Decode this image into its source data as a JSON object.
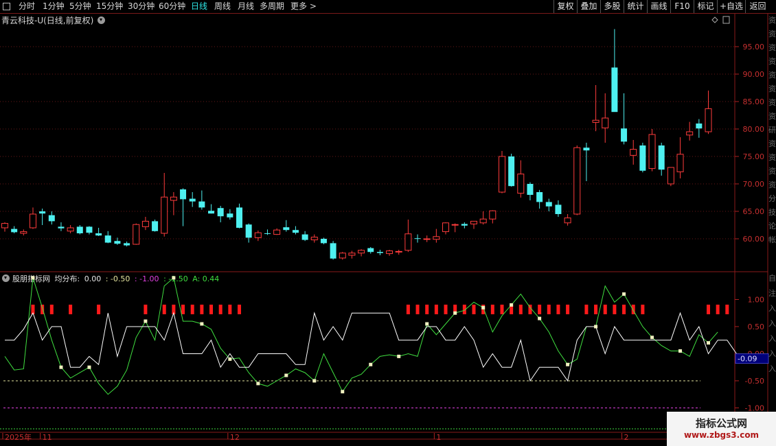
{
  "toolbar": {
    "periods": [
      "分时",
      "1分钟",
      "5分钟",
      "15分钟",
      "30分钟",
      "60分钟",
      "日线",
      "周线",
      "月线",
      "多周期",
      "更多 >"
    ],
    "active_period": "日线",
    "buttons": [
      "复权",
      "叠加",
      "多股",
      "统计",
      "画线",
      "F10",
      "标记",
      "+自选",
      "返回"
    ]
  },
  "main_title": "青云科技-U(日线,前复权)",
  "indicator": {
    "name": "股朋指标网",
    "label": "均分布:",
    "values": [
      {
        "text": "0.00",
        "color": "#e8e8e8"
      },
      {
        "text": ": -0.50",
        "color": "#e6e6a0"
      },
      {
        "text": ": -1.00",
        "color": "#e040e0"
      },
      {
        "text": ": -1.50",
        "color": "#40e040"
      },
      {
        "text": "A: 0.44",
        "color": "#40e040"
      }
    ],
    "current_value": "-0.09"
  },
  "watermark": {
    "title": "指标公式网",
    "url": "www.zbgs3.com"
  },
  "right_strip_chars": [
    "资",
    "资",
    "资",
    "资",
    "资",
    "资",
    "资",
    "资",
    "研",
    "资",
    "资",
    "资",
    "资",
    "分",
    "技",
    "论",
    "帐"
  ],
  "right_strip_chars_lower": [
    "自",
    "注",
    "入",
    "入",
    "入",
    "入",
    "入"
  ],
  "chart_data": [
    {
      "type": "candlestick",
      "title": "青云科技-U(日线,前复权)",
      "y_ticks": [
        60,
        65,
        70,
        75,
        80,
        85,
        90,
        95
      ],
      "ylim": [
        54,
        101
      ],
      "grid": true,
      "date_labels": [
        {
          "label": "2025年",
          "index": 0
        },
        {
          "label": "11",
          "index": 4
        },
        {
          "label": "12",
          "index": 24
        },
        {
          "label": "1",
          "index": 46
        },
        {
          "label": "2",
          "index": 66
        }
      ],
      "up_color": "#ff3c3c",
      "down_color": "#4ef0f0",
      "candles": [
        [
          62.0,
          63.0,
          61.3,
          62.8
        ],
        [
          61.8,
          62.3,
          61.0,
          61.2
        ],
        [
          61.0,
          61.7,
          60.6,
          61.3
        ],
        [
          62.0,
          65.7,
          61.8,
          64.5
        ],
        [
          65.0,
          65.5,
          62.5,
          64.6
        ],
        [
          64.3,
          65.0,
          62.6,
          63.2
        ],
        [
          62.2,
          63.0,
          61.4,
          61.9
        ],
        [
          61.4,
          62.5,
          61.0,
          62.0
        ],
        [
          62.2,
          62.5,
          60.8,
          61.0
        ],
        [
          62.2,
          62.3,
          60.8,
          61.1
        ],
        [
          61.0,
          62.0,
          60.5,
          60.6
        ],
        [
          60.6,
          61.4,
          59.2,
          59.3
        ],
        [
          59.6,
          60.2,
          58.9,
          59.1
        ],
        [
          59.2,
          59.5,
          58.6,
          58.8
        ],
        [
          59.0,
          62.8,
          58.9,
          62.6
        ],
        [
          62.2,
          64.0,
          61.6,
          63.2
        ],
        [
          63.2,
          63.5,
          61.3,
          61.4
        ],
        [
          61.0,
          72.0,
          60.4,
          67.6
        ],
        [
          67.0,
          68.5,
          64.3,
          67.6
        ],
        [
          69.0,
          69.2,
          62.3,
          67.2
        ],
        [
          67.3,
          68.5,
          65.8,
          66.8
        ],
        [
          66.8,
          68.8,
          65.3,
          65.7
        ],
        [
          65.1,
          66.3,
          64.6,
          64.6
        ],
        [
          65.6,
          66.0,
          63.0,
          64.1
        ],
        [
          64.6,
          65.4,
          63.5,
          63.9
        ],
        [
          65.7,
          66.4,
          61.9,
          62.0
        ],
        [
          62.6,
          62.8,
          59.3,
          60.2
        ],
        [
          60.2,
          61.5,
          59.6,
          61.1
        ],
        [
          61.0,
          61.7,
          60.7,
          60.9
        ],
        [
          60.8,
          61.9,
          60.7,
          61.6
        ],
        [
          62.1,
          63.4,
          61.3,
          61.6
        ],
        [
          61.6,
          62.3,
          60.8,
          61.1
        ],
        [
          60.8,
          61.4,
          59.6,
          59.8
        ],
        [
          59.8,
          60.8,
          59.3,
          60.3
        ],
        [
          60.0,
          60.2,
          59.0,
          59.2
        ],
        [
          59.2,
          59.6,
          56.2,
          56.4
        ],
        [
          56.5,
          57.6,
          56.2,
          57.4
        ],
        [
          57.0,
          57.8,
          56.4,
          57.4
        ],
        [
          57.4,
          58.1,
          56.8,
          57.9
        ],
        [
          58.3,
          58.5,
          57.3,
          57.6
        ],
        [
          57.6,
          58.0,
          57.0,
          57.4
        ],
        [
          57.3,
          58.0,
          56.9,
          57.8
        ],
        [
          57.6,
          58.0,
          57.1,
          57.7
        ],
        [
          57.9,
          63.5,
          57.6,
          60.9
        ],
        [
          60.1,
          60.8,
          59.3,
          60.0
        ],
        [
          60.0,
          60.6,
          59.4,
          60.0
        ],
        [
          59.9,
          61.8,
          59.3,
          60.4
        ],
        [
          61.3,
          63.0,
          60.8,
          62.9
        ],
        [
          62.6,
          62.8,
          61.2,
          62.6
        ],
        [
          62.7,
          63.0,
          61.9,
          62.4
        ],
        [
          62.7,
          63.2,
          61.8,
          63.2
        ],
        [
          62.9,
          65.0,
          62.6,
          63.6
        ],
        [
          63.6,
          65.2,
          62.8,
          65.1
        ],
        [
          68.5,
          76.0,
          68.3,
          75.0
        ],
        [
          75.0,
          75.5,
          69.5,
          69.6
        ],
        [
          68.3,
          74.3,
          67.5,
          71.8
        ],
        [
          70.0,
          70.3,
          67.0,
          68.0
        ],
        [
          68.5,
          68.9,
          65.5,
          66.7
        ],
        [
          66.7,
          67.3,
          65.0,
          65.9
        ],
        [
          66.2,
          67.0,
          64.0,
          64.5
        ],
        [
          62.9,
          64.5,
          62.4,
          63.8
        ],
        [
          64.5,
          77.0,
          64.3,
          76.6
        ],
        [
          76.6,
          77.5,
          70.5,
          76.1
        ],
        [
          81.2,
          88.0,
          79.6,
          81.6
        ],
        [
          80.2,
          86.5,
          77.5,
          82.0
        ],
        [
          91.2,
          98.2,
          84.2,
          83.1
        ],
        [
          80.1,
          86.5,
          77.2,
          77.7
        ],
        [
          75.2,
          78.0,
          73.5,
          76.3
        ],
        [
          77.0,
          77.5,
          72.1,
          72.4
        ],
        [
          72.8,
          80.0,
          72.3,
          79.0
        ],
        [
          77.0,
          77.5,
          71.5,
          72.6
        ],
        [
          70.0,
          73.0,
          69.6,
          73.0
        ],
        [
          72.2,
          78.5,
          71.0,
          75.4
        ],
        [
          78.9,
          81.3,
          77.9,
          79.5
        ],
        [
          81.0,
          81.8,
          78.4,
          80.1
        ],
        [
          79.5,
          87.0,
          79.1,
          83.7
        ]
      ]
    },
    {
      "type": "line",
      "title": "股朋指标网 均分布",
      "y_ticks": [
        1.0,
        0.5,
        0,
        -0.5,
        -1.0
      ],
      "ylim": [
        -1.45,
        1.5
      ],
      "reference_lines": [
        {
          "value": -0.5,
          "color": "#e6e6a0"
        },
        {
          "value": -1.0,
          "color": "#e040e0"
        },
        {
          "value": -1.5,
          "color": "#40e040"
        }
      ],
      "series": [
        {
          "color": "#40e040",
          "values": [
            -0.05,
            -0.3,
            -0.28,
            1.4,
            0.85,
            0.25,
            -0.25,
            -0.45,
            -0.35,
            -0.25,
            -0.55,
            -0.75,
            -0.6,
            -0.3,
            0.3,
            0.6,
            0.25,
            1.25,
            1.4,
            0.6,
            0.6,
            0.55,
            0.45,
            0.1,
            -0.1,
            -0.08,
            -0.35,
            -0.55,
            -0.6,
            -0.5,
            -0.4,
            -0.28,
            -0.35,
            -0.5,
            0.0,
            -0.35,
            -0.7,
            -0.45,
            -0.38,
            -0.2,
            -0.05,
            -0.02,
            -0.05,
            0.0,
            -0.05,
            0.55,
            0.35,
            0.55,
            0.75,
            0.8,
            0.95,
            0.85,
            0.4,
            0.7,
            0.9,
            1.1,
            0.85,
            0.65,
            0.4,
            0.05,
            -0.2,
            -0.1,
            0.5,
            0.5,
            1.25,
            0.95,
            1.1,
            0.8,
            0.5,
            0.3,
            0.15,
            0.05,
            0.05,
            -0.05,
            0.35,
            0.2,
            0.4
          ]
        },
        {
          "color": "#ffffff",
          "values": [
            0.25,
            0.25,
            0.45,
            0.75,
            0.25,
            0.5,
            0.5,
            -0.25,
            -0.25,
            -0.05,
            -0.2,
            0.75,
            -0.05,
            0.5,
            0.5,
            0.5,
            0.5,
            0.25,
            0.75,
            0.0,
            0.0,
            0.0,
            0.25,
            -0.25,
            0.0,
            -0.25,
            -0.25,
            0.0,
            0.0,
            0.0,
            0.0,
            -0.2,
            -0.2,
            0.75,
            0.25,
            0.5,
            0.25,
            0.75,
            0.75,
            0.75,
            0.75,
            0.75,
            0.25,
            0.25,
            0.25,
            0.5,
            0.5,
            0.25,
            0.25,
            0.5,
            0.25,
            -0.25,
            0.0,
            -0.25,
            -0.25,
            0.25,
            -0.5,
            -0.25,
            -0.25,
            -0.25,
            -0.5,
            0.25,
            0.5,
            0.5,
            0.0,
            0.5,
            0.25,
            0.25,
            0.25,
            0.25,
            0.25,
            0.25,
            0.75,
            0.25,
            0.5,
            0.0,
            0.25,
            0.25,
            0.0
          ]
        }
      ],
      "marker_indices": [
        3,
        6,
        9,
        15,
        18,
        21,
        24,
        27,
        30,
        33,
        36,
        39,
        42,
        45,
        48,
        51,
        54,
        57,
        60,
        63,
        66,
        69,
        72,
        75
      ],
      "bar_indices": [
        3,
        4,
        5,
        7,
        10,
        15,
        17,
        18,
        19,
        20,
        21,
        22,
        23,
        24,
        25,
        43,
        44,
        45,
        46,
        47,
        48,
        49,
        50,
        51,
        52,
        53,
        54,
        55,
        56,
        57,
        58,
        59,
        60,
        62,
        63,
        64,
        65,
        66,
        67,
        68,
        75,
        76,
        77
      ],
      "current_value": -0.09
    }
  ]
}
